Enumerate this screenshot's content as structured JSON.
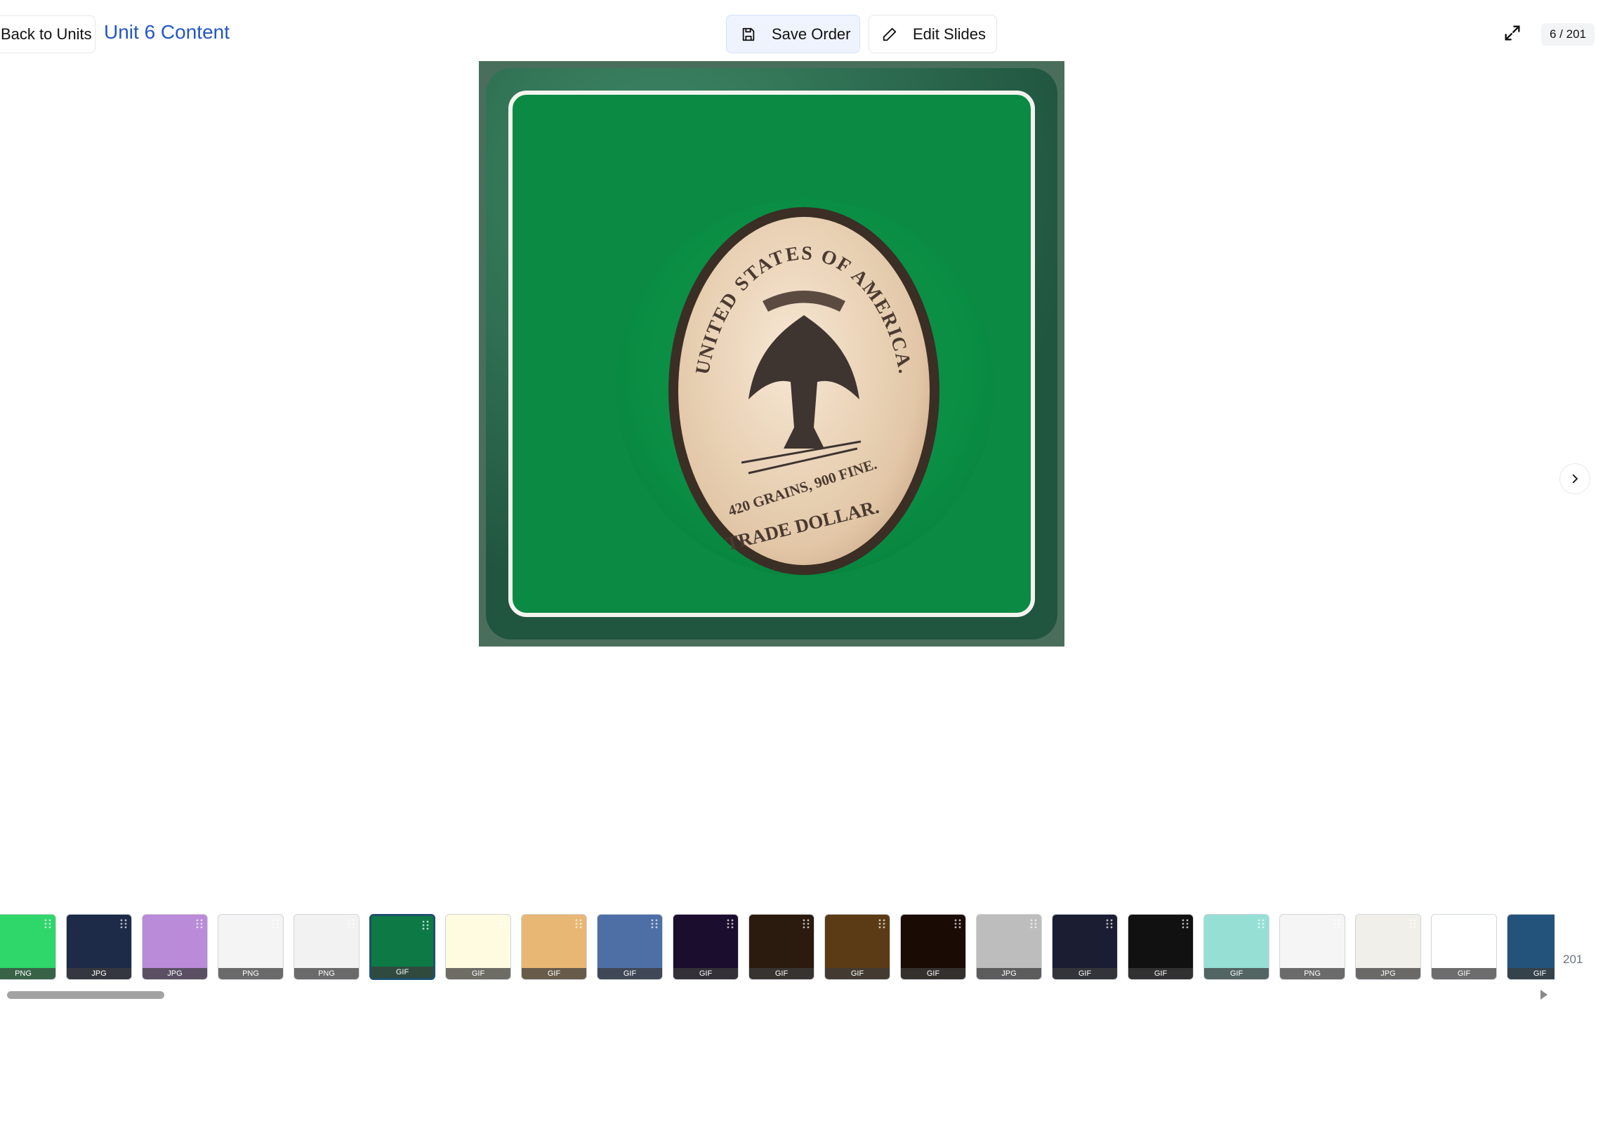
{
  "header": {
    "back_label": "Back to Units",
    "title": "Unit 6 Content",
    "save_label": "Save Order",
    "edit_label": "Edit Slides",
    "counter": "6 / 201"
  },
  "slide": {
    "coin_top_text": "UNITED STATES OF AMERICA.",
    "coin_mid_text": "420 GRAINS, 900 FINE.",
    "coin_bottom_text": "TRADE DOLLAR."
  },
  "filmstrip": {
    "thumbnails": [
      {
        "type": "PNG",
        "bg": "#2fd66a"
      },
      {
        "type": "JPG",
        "bg": "#1d2a48"
      },
      {
        "type": "JPG",
        "bg": "#b98bd8"
      },
      {
        "type": "PNG",
        "bg": "#f4f4f4"
      },
      {
        "type": "PNG",
        "bg": "#f2f2f2"
      },
      {
        "type": "GIF",
        "bg": "#0d7a46",
        "active": true
      },
      {
        "type": "GIF",
        "bg": "#fffbe0"
      },
      {
        "type": "GIF",
        "bg": "#e8b773"
      },
      {
        "type": "GIF",
        "bg": "#4e6ea6"
      },
      {
        "type": "GIF",
        "bg": "#1b0d2e"
      },
      {
        "type": "GIF",
        "bg": "#2b1b0e"
      },
      {
        "type": "GIF",
        "bg": "#5a3b15"
      },
      {
        "type": "GIF",
        "bg": "#1a0c05"
      },
      {
        "type": "JPG",
        "bg": "#bdbdbd"
      },
      {
        "type": "GIF",
        "bg": "#1b1d33"
      },
      {
        "type": "GIF",
        "bg": "#111111"
      },
      {
        "type": "GIF",
        "bg": "#96dfd5"
      },
      {
        "type": "PNG",
        "bg": "#f5f5f5"
      },
      {
        "type": "JPG",
        "bg": "#f1efe9"
      },
      {
        "type": "GIF",
        "bg": "#ffffff"
      },
      {
        "type": "GIF",
        "bg": "#23527a"
      }
    ],
    "total": "201"
  },
  "colors": {
    "accent": "#2456c4",
    "save_bg": "#eef3fd"
  }
}
